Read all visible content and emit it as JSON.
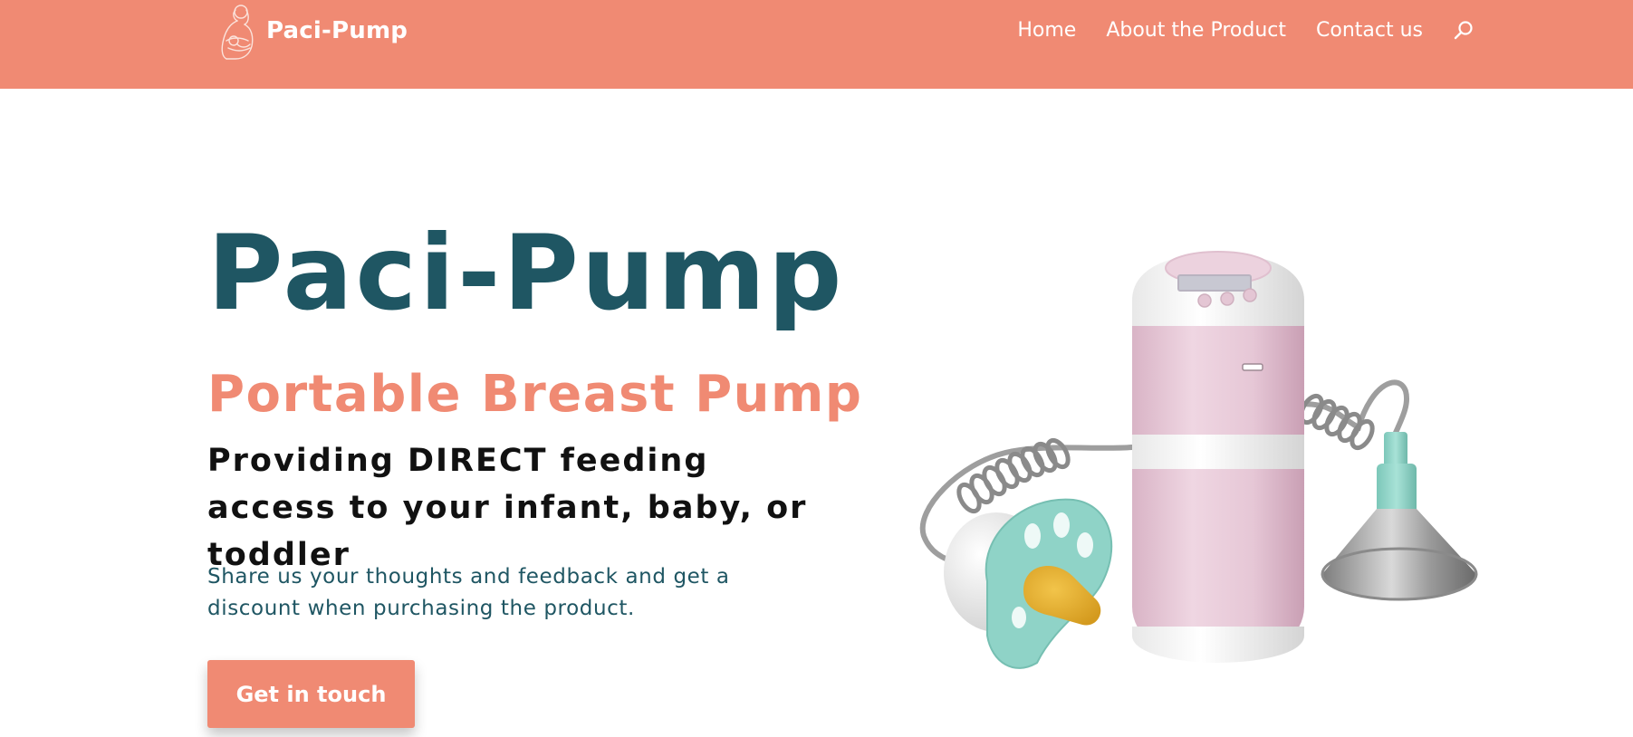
{
  "header": {
    "brand": "Paci-Pump",
    "nav": [
      "Home",
      "About the Product",
      "Contact us"
    ],
    "search_icon": "search-icon",
    "background": "#f08a73"
  },
  "hero": {
    "title": "Paci-Pump",
    "subtitle": "Portable Breast Pump",
    "tagline": "Providing DIRECT feeding access to your infant, baby, or toddler",
    "description": "Share us your thoughts and feedback and get a discount when purchasing the product.",
    "cta_label": "Get in touch"
  },
  "colors": {
    "accent": "#f08a73",
    "title": "#1f5663",
    "tagline": "#111111",
    "pump_body": "#e8c9d6",
    "pacifier": "#8fd3c7"
  }
}
